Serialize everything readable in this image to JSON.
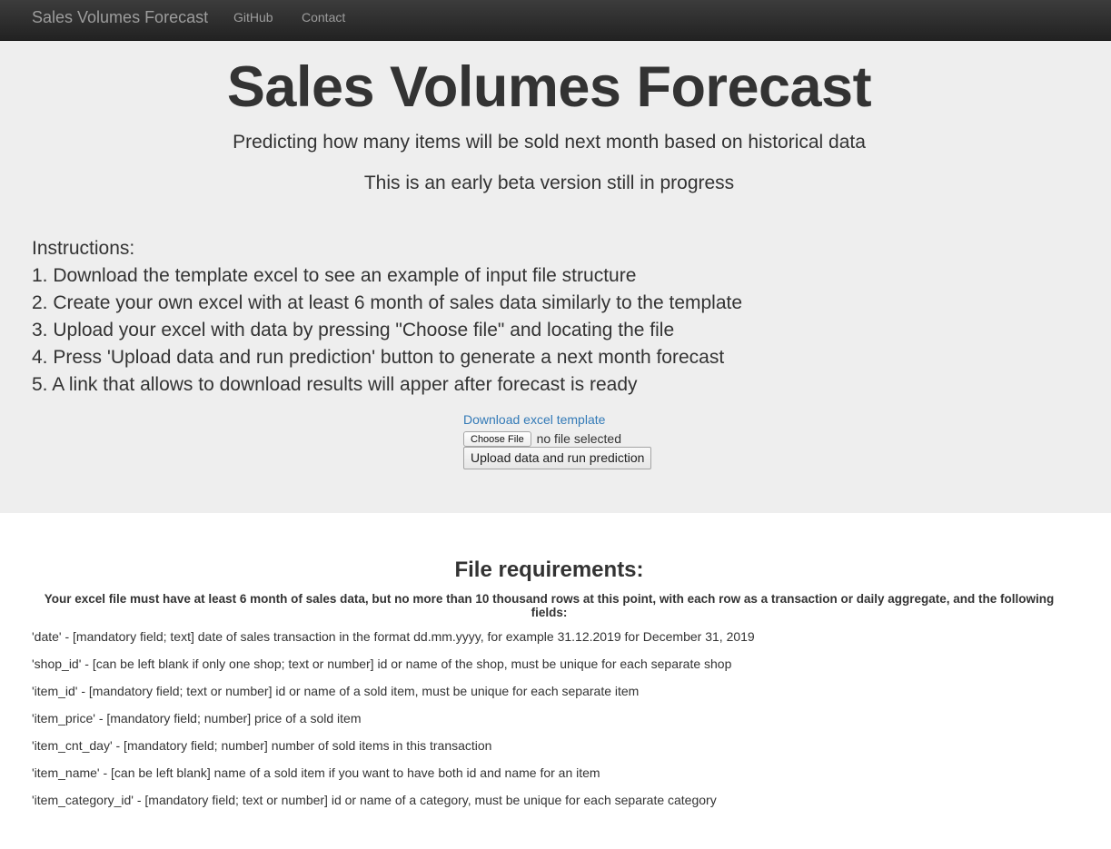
{
  "navbar": {
    "brand": "Sales Volumes Forecast",
    "links": [
      "GitHub",
      "Contact"
    ]
  },
  "hero": {
    "title": "Sales Volumes Forecast",
    "subtitle": "Predicting how many items will be sold next month based on historical data",
    "beta_note": "This is an early beta version still in progress"
  },
  "instructions": {
    "heading": "Instructions:",
    "steps": [
      "1. Download the template excel to see an example of input file structure",
      "2. Create your own excel with at least 6 month of sales data similarly to the template",
      "3. Upload your excel with data by pressing \"Choose file\" and locating the file",
      "4. Press 'Upload data and run prediction' button to generate a next month forecast",
      "5. A link that allows to download results will apper after forecast is ready"
    ]
  },
  "upload": {
    "download_link": "Download excel template",
    "choose_file_label": "Choose File",
    "file_status": "no file selected",
    "submit_label": "Upload data and run prediction"
  },
  "requirements": {
    "title": "File requirements:",
    "intro": "Your excel file must have at least 6 month of sales data, but no more than 10 thousand rows at this point, with each row as a transaction or daily aggregate, and the following fields:",
    "fields": [
      "'date' - [mandatory field; text] date of sales transaction in the format dd.mm.yyyy, for example 31.12.2019 for December 31, 2019",
      "'shop_id' - [can be left blank if only one shop; text or number] id or name of the shop, must be unique for each separate shop",
      "'item_id' - [mandatory field; text or number] id or name of a sold item, must be unique for each separate item",
      "'item_price' - [mandatory field; number] price of a sold item",
      "'item_cnt_day' - [mandatory field; number] number of sold items in this transaction",
      "'item_name' - [can be left blank] name of a sold item if you want to have both id and name for an item",
      "'item_category_id' - [mandatory field; text or number] id or name of a category, must be unique for each separate category"
    ]
  },
  "colors": {
    "navbar_bg": "#222222",
    "navbar_text": "#9d9d9d",
    "jumbotron_bg": "#eeeeee",
    "link": "#337ab7",
    "text": "#333333"
  }
}
